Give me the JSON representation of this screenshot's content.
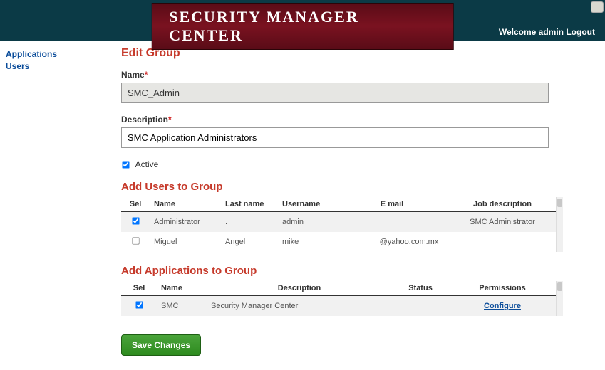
{
  "banner": {
    "title": "SECURITY MANAGER CENTER",
    "welcome_prefix": "Welcome ",
    "user_link": "admin",
    "logout_link": "Logout"
  },
  "sidebar": {
    "items": [
      {
        "label": "Applications"
      },
      {
        "label": "Users"
      }
    ]
  },
  "page": {
    "title": "Edit Group",
    "name_label": "Name",
    "name_value": "SMC_Admin",
    "description_label": "Description",
    "description_value": "SMC Application Administrators",
    "active_label": "Active",
    "active_checked": true
  },
  "users_section": {
    "title": "Add Users to Group",
    "headers": {
      "sel": "Sel",
      "name": "Name",
      "last": "Last name",
      "user": "Username",
      "email": "E mail",
      "job": "Job description"
    },
    "rows": [
      {
        "checked": true,
        "name": "Administrator",
        "last": ".",
        "user": "admin",
        "email": "",
        "job": "SMC Administrator"
      },
      {
        "checked": false,
        "name": "Miguel",
        "last": "Angel",
        "user": "mike",
        "email": "@yahoo.com.mx",
        "job": ""
      }
    ]
  },
  "apps_section": {
    "title": "Add Applications to Group",
    "headers": {
      "sel": "Sel",
      "name": "Name",
      "desc": "Description",
      "status": "Status",
      "perms": "Permissions"
    },
    "rows": [
      {
        "checked": true,
        "name": "SMC",
        "desc": "Security Manager Center",
        "status": "",
        "perms_link": "Configure"
      }
    ]
  },
  "actions": {
    "save_label": "Save Changes"
  }
}
